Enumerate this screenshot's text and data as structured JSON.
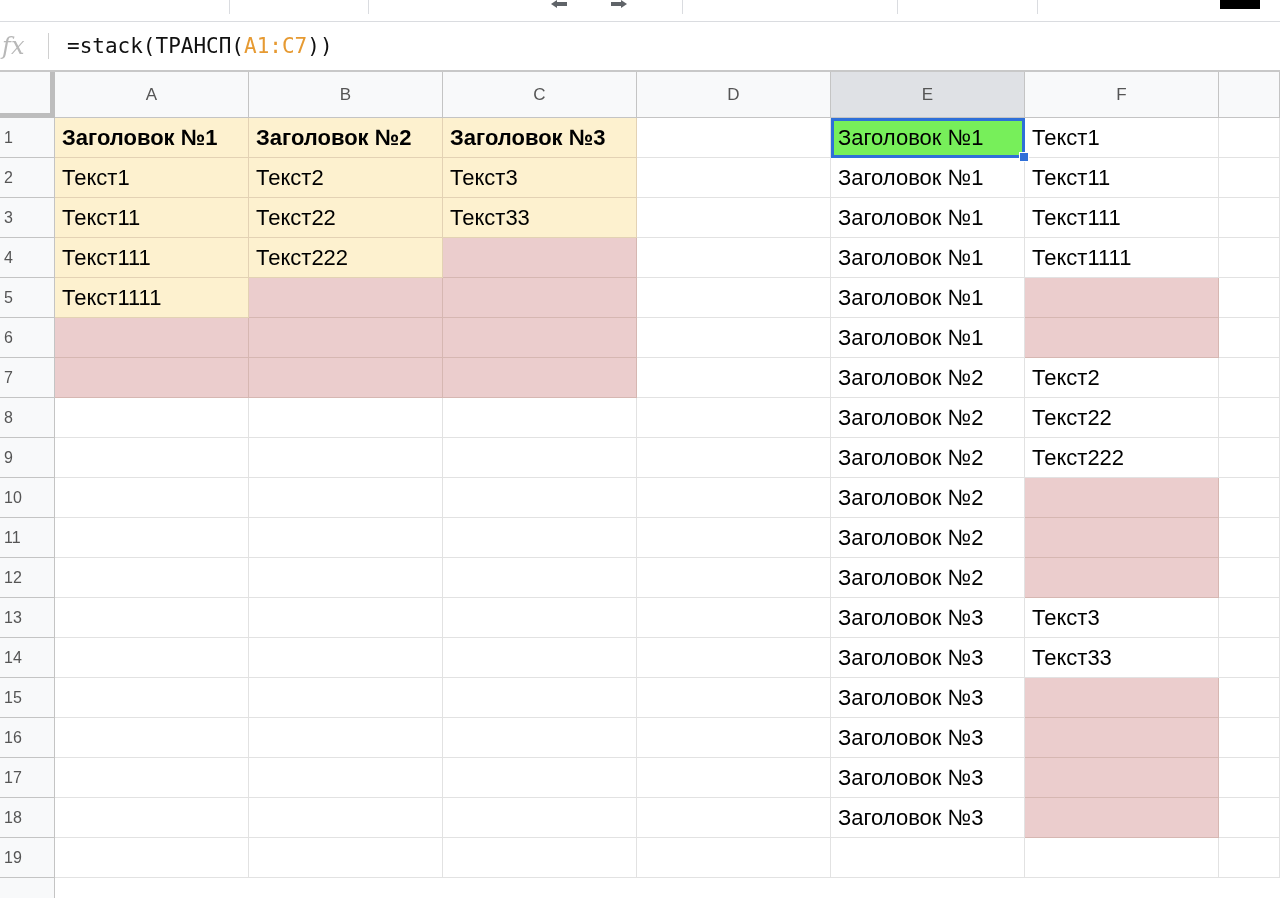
{
  "formula_bar": {
    "label": "fx",
    "parts": [
      {
        "text": "=stack(ТРАНСП(",
        "kind": "plain"
      },
      {
        "text": "A1:C7",
        "kind": "range"
      },
      {
        "text": "))",
        "kind": "plain"
      }
    ]
  },
  "columns": [
    {
      "label": "A",
      "selected": false
    },
    {
      "label": "B",
      "selected": false
    },
    {
      "label": "C",
      "selected": false
    },
    {
      "label": "D",
      "selected": false
    },
    {
      "label": "E",
      "selected": true
    },
    {
      "label": "F",
      "selected": false
    }
  ],
  "rows": [
    {
      "number": "1",
      "cells": [
        {
          "text": "Заголовок №1",
          "color": "#fdf1cf",
          "bold": true,
          "selected": false
        },
        {
          "text": "Заголовок №2",
          "color": "#fdf1cf",
          "bold": true,
          "selected": false
        },
        {
          "text": "Заголовок №3",
          "color": "#fdf1cf",
          "bold": true,
          "selected": false
        },
        {
          "selected": false
        },
        {
          "text": "Заголовок №1",
          "color": "#77ef5a",
          "selected": true
        },
        {
          "text": "Текст1",
          "selected": false
        }
      ]
    },
    {
      "number": "2",
      "cells": [
        {
          "text": "Текст1",
          "color": "#fdf1cf",
          "selected": false
        },
        {
          "text": "Текст2",
          "color": "#fdf1cf",
          "selected": false
        },
        {
          "text": "Текст3",
          "color": "#fdf1cf",
          "selected": false
        },
        {
          "selected": false
        },
        {
          "text": "Заголовок №1",
          "selected": false
        },
        {
          "text": "Текст11",
          "selected": false
        }
      ]
    },
    {
      "number": "3",
      "cells": [
        {
          "text": "Текст11",
          "color": "#fdf1cf",
          "selected": false
        },
        {
          "text": "Текст22",
          "color": "#fdf1cf",
          "selected": false
        },
        {
          "text": "Текст33",
          "color": "#fdf1cf",
          "selected": false
        },
        {
          "selected": false
        },
        {
          "text": "Заголовок №1",
          "selected": false
        },
        {
          "text": "Текст111",
          "selected": false
        }
      ]
    },
    {
      "number": "4",
      "cells": [
        {
          "text": "Текст111",
          "color": "#fdf1cf",
          "selected": false
        },
        {
          "text": "Текст222",
          "color": "#fdf1cf",
          "selected": false
        },
        {
          "color": "#ebcdcd",
          "selected": false
        },
        {
          "selected": false
        },
        {
          "text": "Заголовок №1",
          "selected": false
        },
        {
          "text": "Текст1111",
          "selected": false
        }
      ]
    },
    {
      "number": "5",
      "cells": [
        {
          "text": "Текст1111",
          "color": "#fdf1cf",
          "selected": false
        },
        {
          "color": "#ebcdcd",
          "selected": false
        },
        {
          "color": "#ebcdcd",
          "selected": false
        },
        {
          "selected": false
        },
        {
          "text": "Заголовок №1",
          "selected": false
        },
        {
          "color": "#ebcdcd",
          "selected": false
        }
      ]
    },
    {
      "number": "6",
      "cells": [
        {
          "color": "#ebcdcd",
          "selected": false
        },
        {
          "color": "#ebcdcd",
          "selected": false
        },
        {
          "color": "#ebcdcd",
          "selected": false
        },
        {
          "selected": false
        },
        {
          "text": "Заголовок №1",
          "selected": false
        },
        {
          "color": "#ebcdcd",
          "selected": false
        }
      ]
    },
    {
      "number": "7",
      "cells": [
        {
          "color": "#ebcdcd",
          "selected": false
        },
        {
          "color": "#ebcdcd",
          "selected": false
        },
        {
          "color": "#ebcdcd",
          "selected": false
        },
        {
          "selected": false
        },
        {
          "text": "Заголовок №2",
          "selected": false
        },
        {
          "text": "Текст2",
          "selected": false
        }
      ]
    },
    {
      "number": "8",
      "cells": [
        {
          "selected": false
        },
        {
          "selected": false
        },
        {
          "selected": false
        },
        {
          "selected": false
        },
        {
          "text": "Заголовок №2",
          "selected": false
        },
        {
          "text": "Текст22",
          "selected": false
        }
      ]
    },
    {
      "number": "9",
      "cells": [
        {
          "selected": false
        },
        {
          "selected": false
        },
        {
          "selected": false
        },
        {
          "selected": false
        },
        {
          "text": "Заголовок №2",
          "selected": false
        },
        {
          "text": "Текст222",
          "selected": false
        }
      ]
    },
    {
      "number": "10",
      "cells": [
        {
          "selected": false
        },
        {
          "selected": false
        },
        {
          "selected": false
        },
        {
          "selected": false
        },
        {
          "text": "Заголовок №2",
          "selected": false
        },
        {
          "color": "#ebcdcd",
          "selected": false
        }
      ]
    },
    {
      "number": "11",
      "cells": [
        {
          "selected": false
        },
        {
          "selected": false
        },
        {
          "selected": false
        },
        {
          "selected": false
        },
        {
          "text": "Заголовок №2",
          "selected": false
        },
        {
          "color": "#ebcdcd",
          "selected": false
        }
      ]
    },
    {
      "number": "12",
      "cells": [
        {
          "selected": false
        },
        {
          "selected": false
        },
        {
          "selected": false
        },
        {
          "selected": false
        },
        {
          "text": "Заголовок №2",
          "selected": false
        },
        {
          "color": "#ebcdcd",
          "selected": false
        }
      ]
    },
    {
      "number": "13",
      "cells": [
        {
          "selected": false
        },
        {
          "selected": false
        },
        {
          "selected": false
        },
        {
          "selected": false
        },
        {
          "text": "Заголовок №3",
          "selected": false
        },
        {
          "text": "Текст3",
          "selected": false
        }
      ]
    },
    {
      "number": "14",
      "cells": [
        {
          "selected": false
        },
        {
          "selected": false
        },
        {
          "selected": false
        },
        {
          "selected": false
        },
        {
          "text": "Заголовок №3",
          "selected": false
        },
        {
          "text": "Текст33",
          "selected": false
        }
      ]
    },
    {
      "number": "15",
      "cells": [
        {
          "selected": false
        },
        {
          "selected": false
        },
        {
          "selected": false
        },
        {
          "selected": false
        },
        {
          "text": "Заголовок №3",
          "selected": false
        },
        {
          "color": "#ebcdcd",
          "selected": false
        }
      ]
    },
    {
      "number": "16",
      "cells": [
        {
          "selected": false
        },
        {
          "selected": false
        },
        {
          "selected": false
        },
        {
          "selected": false
        },
        {
          "text": "Заголовок №3",
          "selected": false
        },
        {
          "color": "#ebcdcd",
          "selected": false
        }
      ]
    },
    {
      "number": "17",
      "cells": [
        {
          "selected": false
        },
        {
          "selected": false
        },
        {
          "selected": false
        },
        {
          "selected": false
        },
        {
          "text": "Заголовок №3",
          "selected": false
        },
        {
          "color": "#ebcdcd",
          "selected": false
        }
      ]
    },
    {
      "number": "18",
      "cells": [
        {
          "selected": false
        },
        {
          "selected": false
        },
        {
          "selected": false
        },
        {
          "selected": false
        },
        {
          "text": "Заголовок №3",
          "selected": false
        },
        {
          "color": "#ebcdcd",
          "selected": false
        }
      ]
    },
    {
      "number": "19",
      "cells": [
        {
          "selected": false
        },
        {
          "selected": false
        },
        {
          "selected": false
        },
        {
          "selected": false
        },
        {
          "selected": false
        },
        {
          "selected": false
        }
      ]
    }
  ]
}
